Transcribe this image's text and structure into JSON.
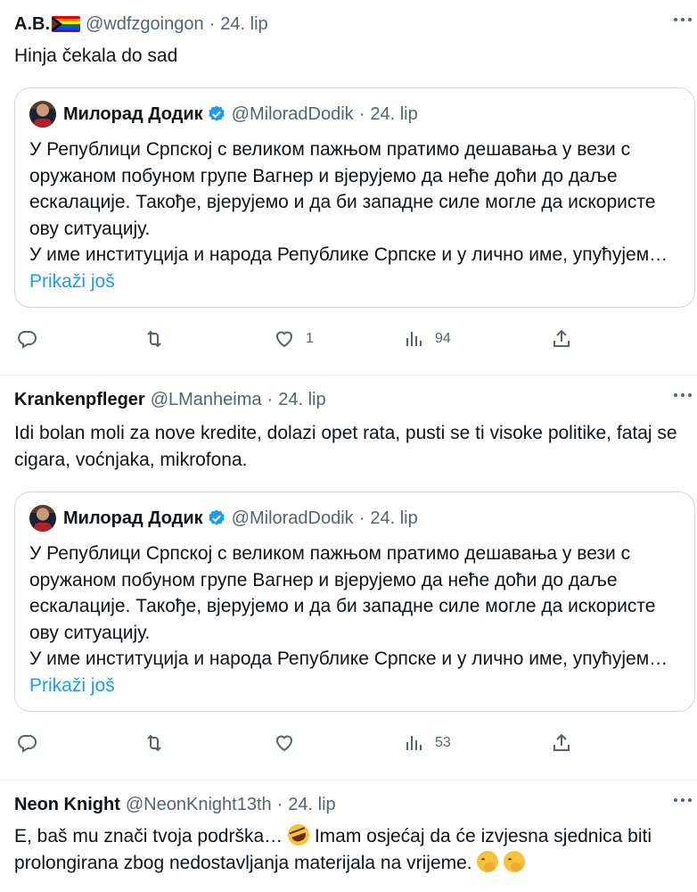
{
  "tweets": [
    {
      "name": "A.B.",
      "handle": "@wdfzgoingon",
      "date": "24. lip",
      "text": "Hinja čekala do sad",
      "quote": {
        "name": "Милорад Додик",
        "handle": "@MiloradDodik",
        "date": "24. lip",
        "text1": "У Републици Српској с великом пажњом пратимо дешавања у вези с оружаном побуном групе Вагнер и вјерујемо да неће доћи до даље ескалације. Такође, вјерујемо и да би западне силе могле да искористе ову ситуацију.",
        "text2": "У име институција и народа Републике Српске и у лично име, упућујем…",
        "show_more": "Prikaži još"
      },
      "likes": "1",
      "views": "94"
    },
    {
      "name": "Krankenpfleger",
      "handle": "@LManheima",
      "date": "24. lip",
      "text": "Idi bolan moli za nove kredite, dolazi opet rata, pusti se ti visoke politike, fataj se cigara, voćnjaka, mikrofona.",
      "quote": {
        "name": "Милорад Додик",
        "handle": "@MiloradDodik",
        "date": "24. lip",
        "text1": "У Републици Српској с великом пажњом пратимо дешавања у вези с оружаном побуном групе Вагнер и вјерујемо да неће доћи до даље ескалације. Такође, вјерујемо и да би западне силе могле да искористе ову ситуацију.",
        "text2": "У име институција и народа Републике Српске и у лично име, упућујем…",
        "show_more": "Prikaži još"
      },
      "likes": "",
      "views": "53"
    },
    {
      "name": "Neon Knight",
      "handle": "@NeonKnight13th",
      "date": "24. lip",
      "text_a": "E, baš mu znači tvoja podrška…",
      "text_b": "Imam osjećaj da će izvjesna sjednica biti prolongirana zbog nedostavljanja materijala na vrijeme."
    }
  ],
  "sep": "·",
  "colors": {
    "secondary": "#536471",
    "link": "#1d9bf0",
    "verified": "#1d9bf0",
    "border": "#cfd9de"
  },
  "icons": [
    "flag-icon",
    "more-icon",
    "avatar",
    "verified-icon",
    "reply-icon",
    "retweet-icon",
    "like-icon",
    "views-icon",
    "share-icon",
    "rofl-emoji",
    "shush-emoji"
  ]
}
